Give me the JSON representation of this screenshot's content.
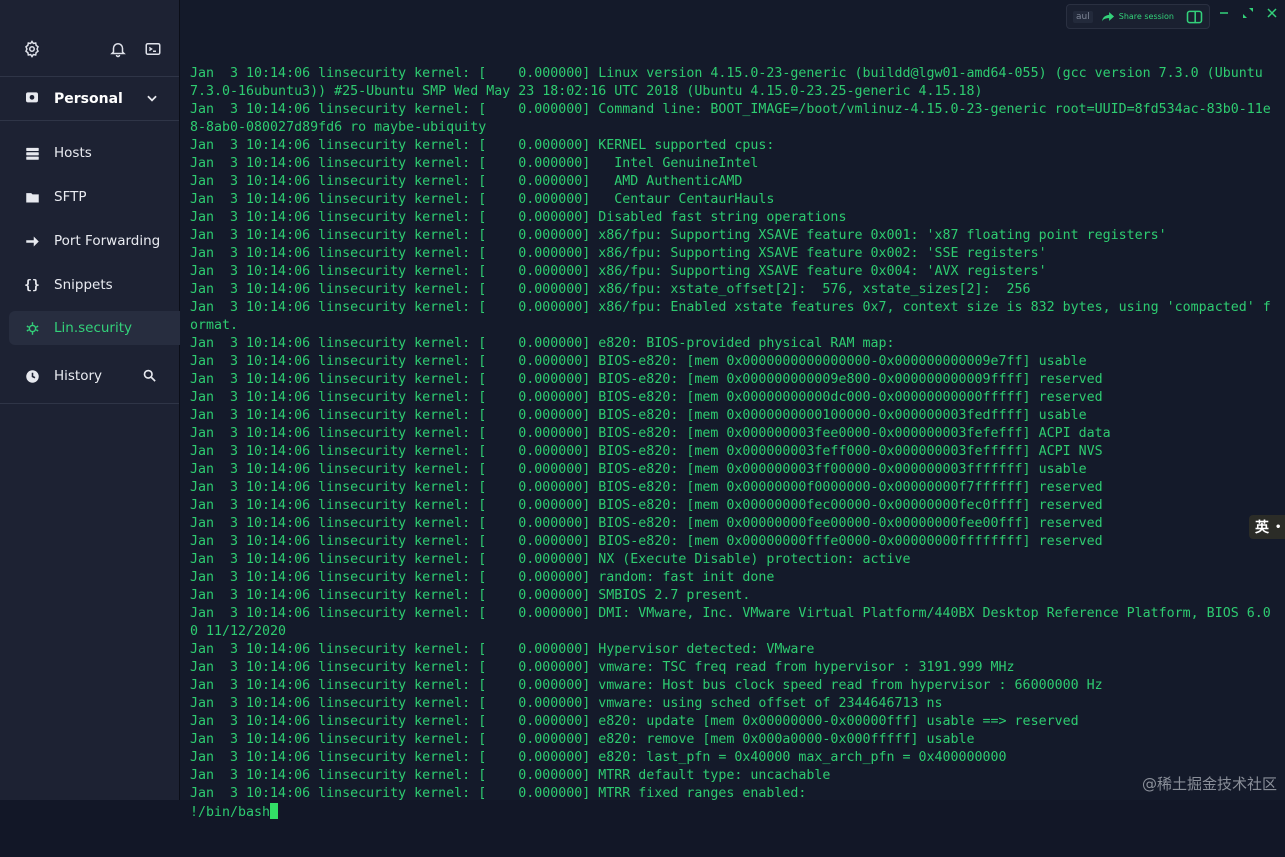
{
  "sidebar": {
    "vault": "Personal",
    "items": [
      {
        "label": "Hosts",
        "icon": "hosts-icon"
      },
      {
        "label": "SFTP",
        "icon": "folder-icon"
      },
      {
        "label": "Port Forwarding",
        "icon": "arrow-forward-icon"
      },
      {
        "label": "Snippets",
        "icon": "braces-icon"
      }
    ],
    "active_host": "Lin.security",
    "history": "History"
  },
  "toolbar": {
    "user": "aul",
    "share_label": "Share session"
  },
  "terminal": {
    "lines": [
      "Jan  3 10:14:06 linsecurity kernel: [    0.000000] Linux version 4.15.0-23-generic (buildd@lgw01-amd64-055) (gcc version 7.3.0 (Ubuntu",
      "7.3.0-16ubuntu3)) #25-Ubuntu SMP Wed May 23 18:02:16 UTC 2018 (Ubuntu 4.15.0-23.25-generic 4.15.18)",
      "Jan  3 10:14:06 linsecurity kernel: [    0.000000] Command line: BOOT_IMAGE=/boot/vmlinuz-4.15.0-23-generic root=UUID=8fd534ac-83b0-11e",
      "8-8ab0-080027d89fd6 ro maybe-ubiquity",
      "Jan  3 10:14:06 linsecurity kernel: [    0.000000] KERNEL supported cpus:",
      "Jan  3 10:14:06 linsecurity kernel: [    0.000000]   Intel GenuineIntel",
      "Jan  3 10:14:06 linsecurity kernel: [    0.000000]   AMD AuthenticAMD",
      "Jan  3 10:14:06 linsecurity kernel: [    0.000000]   Centaur CentaurHauls",
      "Jan  3 10:14:06 linsecurity kernel: [    0.000000] Disabled fast string operations",
      "Jan  3 10:14:06 linsecurity kernel: [    0.000000] x86/fpu: Supporting XSAVE feature 0x001: 'x87 floating point registers'",
      "Jan  3 10:14:06 linsecurity kernel: [    0.000000] x86/fpu: Supporting XSAVE feature 0x002: 'SSE registers'",
      "Jan  3 10:14:06 linsecurity kernel: [    0.000000] x86/fpu: Supporting XSAVE feature 0x004: 'AVX registers'",
      "Jan  3 10:14:06 linsecurity kernel: [    0.000000] x86/fpu: xstate_offset[2]:  576, xstate_sizes[2]:  256",
      "Jan  3 10:14:06 linsecurity kernel: [    0.000000] x86/fpu: Enabled xstate features 0x7, context size is 832 bytes, using 'compacted' f",
      "ormat.",
      "Jan  3 10:14:06 linsecurity kernel: [    0.000000] e820: BIOS-provided physical RAM map:",
      "Jan  3 10:14:06 linsecurity kernel: [    0.000000] BIOS-e820: [mem 0x0000000000000000-0x000000000009e7ff] usable",
      "Jan  3 10:14:06 linsecurity kernel: [    0.000000] BIOS-e820: [mem 0x000000000009e800-0x000000000009ffff] reserved",
      "Jan  3 10:14:06 linsecurity kernel: [    0.000000] BIOS-e820: [mem 0x00000000000dc000-0x00000000000fffff] reserved",
      "Jan  3 10:14:06 linsecurity kernel: [    0.000000] BIOS-e820: [mem 0x0000000000100000-0x000000003fedffff] usable",
      "Jan  3 10:14:06 linsecurity kernel: [    0.000000] BIOS-e820: [mem 0x000000003fee0000-0x000000003fefefff] ACPI data",
      "Jan  3 10:14:06 linsecurity kernel: [    0.000000] BIOS-e820: [mem 0x000000003feff000-0x000000003fefffff] ACPI NVS",
      "Jan  3 10:14:06 linsecurity kernel: [    0.000000] BIOS-e820: [mem 0x000000003ff00000-0x000000003fffffff] usable",
      "Jan  3 10:14:06 linsecurity kernel: [    0.000000] BIOS-e820: [mem 0x00000000f0000000-0x00000000f7ffffff] reserved",
      "Jan  3 10:14:06 linsecurity kernel: [    0.000000] BIOS-e820: [mem 0x00000000fec00000-0x00000000fec0ffff] reserved",
      "Jan  3 10:14:06 linsecurity kernel: [    0.000000] BIOS-e820: [mem 0x00000000fee00000-0x00000000fee00fff] reserved",
      "Jan  3 10:14:06 linsecurity kernel: [    0.000000] BIOS-e820: [mem 0x00000000fffe0000-0x00000000ffffffff] reserved",
      "Jan  3 10:14:06 linsecurity kernel: [    0.000000] NX (Execute Disable) protection: active",
      "Jan  3 10:14:06 linsecurity kernel: [    0.000000] random: fast init done",
      "Jan  3 10:14:06 linsecurity kernel: [    0.000000] SMBIOS 2.7 present.",
      "Jan  3 10:14:06 linsecurity kernel: [    0.000000] DMI: VMware, Inc. VMware Virtual Platform/440BX Desktop Reference Platform, BIOS 6.0",
      "0 11/12/2020",
      "Jan  3 10:14:06 linsecurity kernel: [    0.000000] Hypervisor detected: VMware",
      "Jan  3 10:14:06 linsecurity kernel: [    0.000000] vmware: TSC freq read from hypervisor : 3191.999 MHz",
      "Jan  3 10:14:06 linsecurity kernel: [    0.000000] vmware: Host bus clock speed read from hypervisor : 66000000 Hz",
      "Jan  3 10:14:06 linsecurity kernel: [    0.000000] vmware: using sched offset of 2344646713 ns",
      "Jan  3 10:14:06 linsecurity kernel: [    0.000000] e820: update [mem 0x00000000-0x00000fff] usable ==> reserved",
      "Jan  3 10:14:06 linsecurity kernel: [    0.000000] e820: remove [mem 0x000a0000-0x000fffff] usable",
      "Jan  3 10:14:06 linsecurity kernel: [    0.000000] e820: last_pfn = 0x40000 max_arch_pfn = 0x400000000",
      "Jan  3 10:14:06 linsecurity kernel: [    0.000000] MTRR default type: uncachable",
      "Jan  3 10:14:06 linsecurity kernel: [    0.000000] MTRR fixed ranges enabled:"
    ],
    "prompt": "!/bin/bash"
  },
  "ime_indicator": "英",
  "watermark": "@稀土掘金技术社区",
  "colors": {
    "terminal_text": "#2ecc71",
    "accent": "#33d17a",
    "sidebar_bg": "#1d2233",
    "terminal_bg": "#141a2a"
  }
}
